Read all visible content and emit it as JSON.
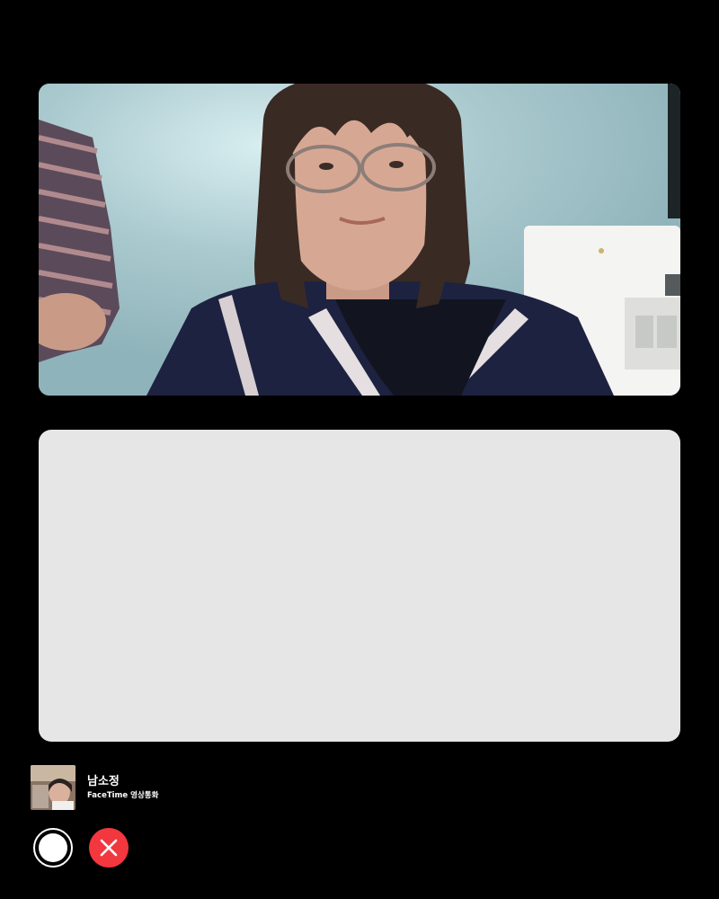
{
  "call": {
    "caller_name": "남소정",
    "subtitle": "FaceTime 영상통화"
  },
  "video": {
    "remote_stream": "person-with-glasses-video",
    "placeholder_panel": "empty-video-area"
  },
  "controls": {
    "accept_icon": "white-circle-icon",
    "decline_icon": "close-icon"
  },
  "colors": {
    "background": "#000000",
    "placeholder": "#e6e6e6",
    "decline": "#f2373f",
    "accept": "#ffffff"
  }
}
